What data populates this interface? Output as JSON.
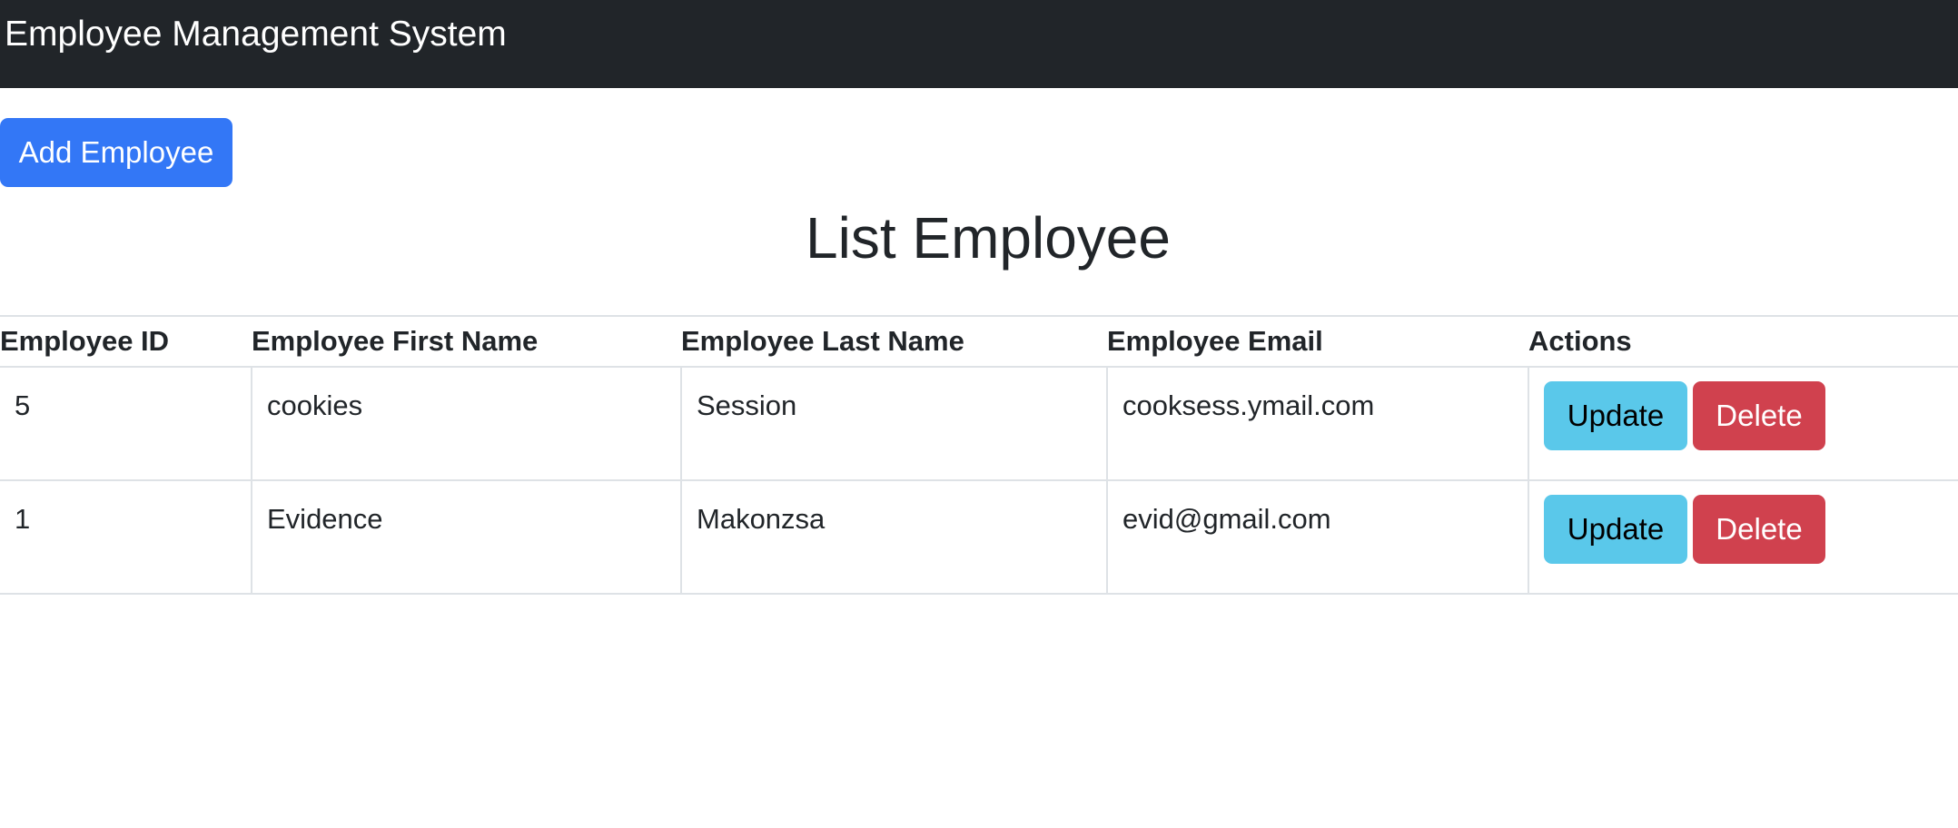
{
  "navbar": {
    "brand": "Employee Management System"
  },
  "toolbar": {
    "add_label": "Add Employee"
  },
  "page": {
    "title": "List Employee"
  },
  "table": {
    "headers": [
      "Employee ID",
      "Employee First Name",
      "Employee Last Name",
      "Employee Email",
      "Actions"
    ],
    "rows": [
      {
        "id": "5",
        "first_name": "cookies",
        "last_name": "Session",
        "email": "cooksess.ymail.com"
      },
      {
        "id": "1",
        "first_name": "Evidence",
        "last_name": "Makonzsa",
        "email": "evid@gmail.com"
      }
    ],
    "update_label": "Update",
    "delete_label": "Delete"
  },
  "colors": {
    "navbar_bg": "#212529",
    "primary": "#3377f6",
    "info": "#5ac8ea",
    "danger": "#d0414e"
  }
}
